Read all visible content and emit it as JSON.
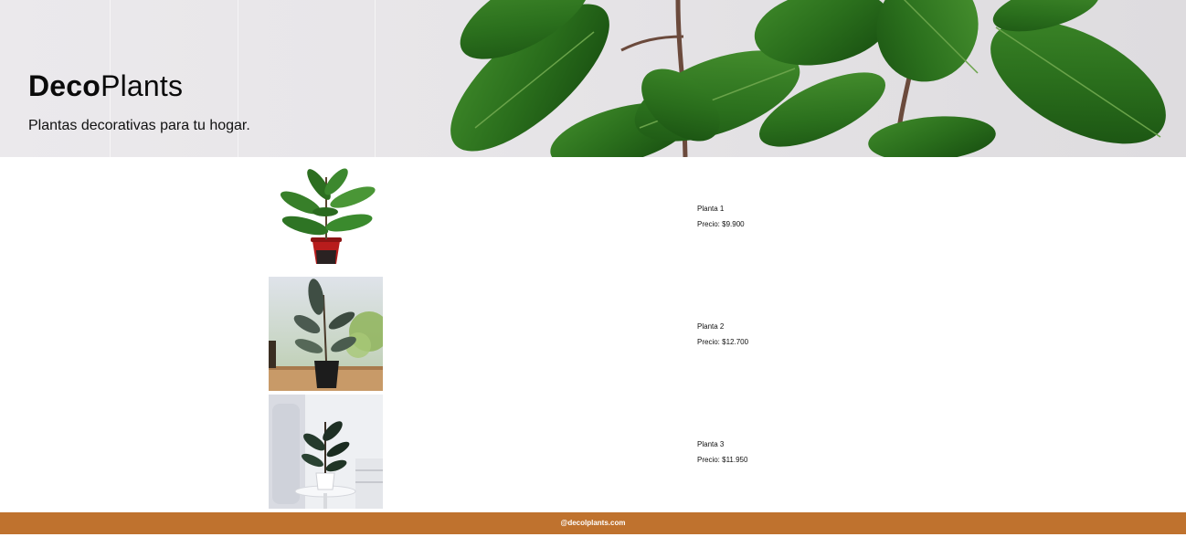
{
  "header": {
    "logo_bold": "Deco",
    "logo_regular": "Plants",
    "tagline": "Plantas decorativas para tu hogar."
  },
  "products": [
    {
      "name": "Planta 1",
      "price": "Precio: $9.900"
    },
    {
      "name": "Planta 2",
      "price": "Precio: $12.700"
    },
    {
      "name": "Planta 3",
      "price": "Precio: $11.950"
    }
  ],
  "footer": {
    "handle": "@decolplants.com"
  },
  "colors": {
    "footer_bg": "#bf722e",
    "leaf_dark": "#1f5a14",
    "leaf_mid": "#2f7a22",
    "hero_bg": "#e7e5e8"
  },
  "icons": [
    "hero-rubber-plant-image",
    "potted-plant-image"
  ]
}
